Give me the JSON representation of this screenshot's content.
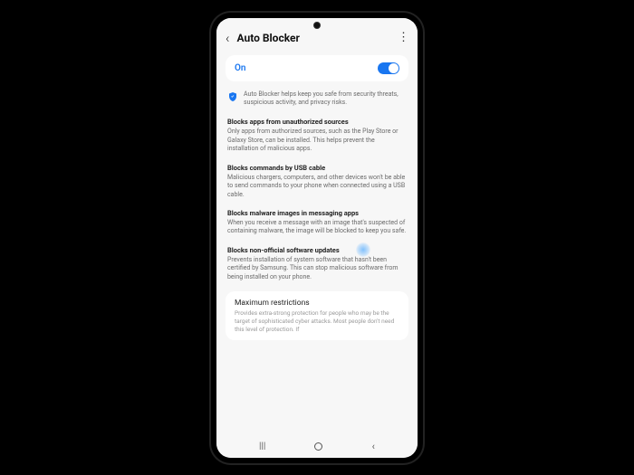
{
  "header": {
    "title": "Auto Blocker"
  },
  "toggle": {
    "label": "On"
  },
  "intro": {
    "text": "Auto Blocker helps keep you safe from security threats, suspicious activity, and privacy risks."
  },
  "sections": [
    {
      "title": "Blocks apps from unauthorized sources",
      "body": "Only apps from authorized sources, such as the Play Store or Galaxy Store, can be installed. This helps prevent the installation of malicious apps."
    },
    {
      "title": "Blocks commands by USB cable",
      "body": "Malicious chargers, computers, and other devices won't be able to send commands to your phone when connected using a USB cable."
    },
    {
      "title": "Blocks malware images in messaging apps",
      "body": "When you receive a message with an image that's suspected of containing malware, the image will be blocked to keep you safe."
    },
    {
      "title": "Blocks non-official software updates",
      "body": "Prevents installation of system software that hasn't been certified by Samsung. This can stop malicious software from being installed on your phone."
    }
  ],
  "max": {
    "title": "Maximum restrictions",
    "body": "Provides extra-strong protection for people who may be the target of sophisticated cyber attacks. Most people don't need this level of protection. If"
  }
}
